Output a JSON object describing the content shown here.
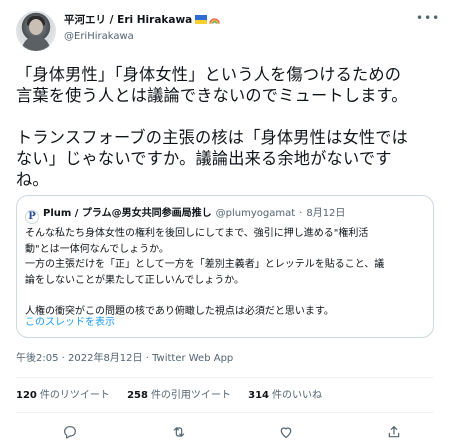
{
  "author": {
    "display_name": "平河エリ / Eri Hirakawa",
    "handle": "@EriHirakawa"
  },
  "tweet": {
    "text": "「身体男性」「身体女性」という人を傷つけるための\n言葉を使う人とは議論できないのでミュートします。\n\nトランスフォーブの主張の核は「身体男性は女性では\nない」じゃないですか。議論出来る余地がないです\nね。"
  },
  "quote": {
    "avatar_letter": "P",
    "name": "Plum / プラム@男女共同参画局推し",
    "handle": "@plumyogamat",
    "date": "8月12日",
    "body": "そんな私たち身体女性の権利を後回しにしてまで、強引に押し進める\"権利活\n動\"とは一体何なんでしょうか。\n一方の主張だけを「正」として一方を「差別主義者」とレッテルを貼ること、議\n論をしないことが果たして正しいんでしょうか。\n\n人権の衝突がこの問題の核であり俯瞰した視点は必須だと思います。",
    "show_thread": "このスレッドを表示"
  },
  "meta": {
    "timestamp": "午後2:05 · 2022年8月12日 · Twitter Web App"
  },
  "stats": {
    "retweets_count": "120",
    "retweets_label": "件のリツイート",
    "quotes_count": "258",
    "quotes_label": "件の引用ツイート",
    "likes_count": "314",
    "likes_label": "件のいいね"
  },
  "icons": {
    "more": "more-icon",
    "reply": "reply-icon",
    "retweet": "retweet-icon",
    "like": "heart-icon",
    "share": "share-icon"
  },
  "colors": {
    "link": "#1d9bf0",
    "secondary_text": "#536471",
    "border": "#cfd9de"
  }
}
